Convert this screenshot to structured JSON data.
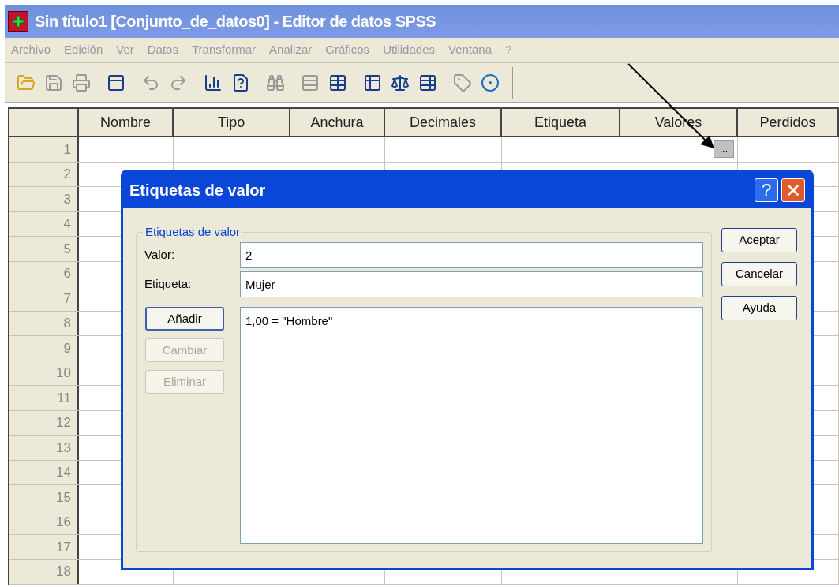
{
  "window": {
    "title": "Sin título1 [Conjunto_de_datos0] - Editor de datos SPSS"
  },
  "menu": [
    "Archivo",
    "Edición",
    "Ver",
    "Datos",
    "Transformar",
    "Analizar",
    "Gráficos",
    "Utilidades",
    "Ventana",
    "?"
  ],
  "grid": {
    "columns": [
      "Nombre",
      "Tipo",
      "Anchura",
      "Decimales",
      "Etiqueta",
      "Valores",
      "Perdidos"
    ],
    "rows": [
      "1",
      "2",
      "3",
      "4",
      "5",
      "6",
      "7",
      "8",
      "9",
      "10",
      "11",
      "12",
      "13",
      "14",
      "15",
      "16",
      "17",
      "18"
    ],
    "ellipsis_button": "..."
  },
  "dialog": {
    "title": "Etiquetas de valor",
    "help": "?",
    "group": {
      "title": "Etiquetas de valor",
      "fields": [
        {
          "label": "Valor:",
          "value": "2"
        },
        {
          "label": "Etiqueta:",
          "value": "Mujer"
        }
      ],
      "buttons": [
        {
          "label": "Añadir",
          "disabled": false
        },
        {
          "label": "Cambiar",
          "disabled": true
        },
        {
          "label": "Eliminar",
          "disabled": true
        }
      ],
      "list": [
        "1,00 = \"Hombre\""
      ]
    },
    "buttons": [
      "Aceptar",
      "Cancelar",
      "Ayuda"
    ]
  }
}
